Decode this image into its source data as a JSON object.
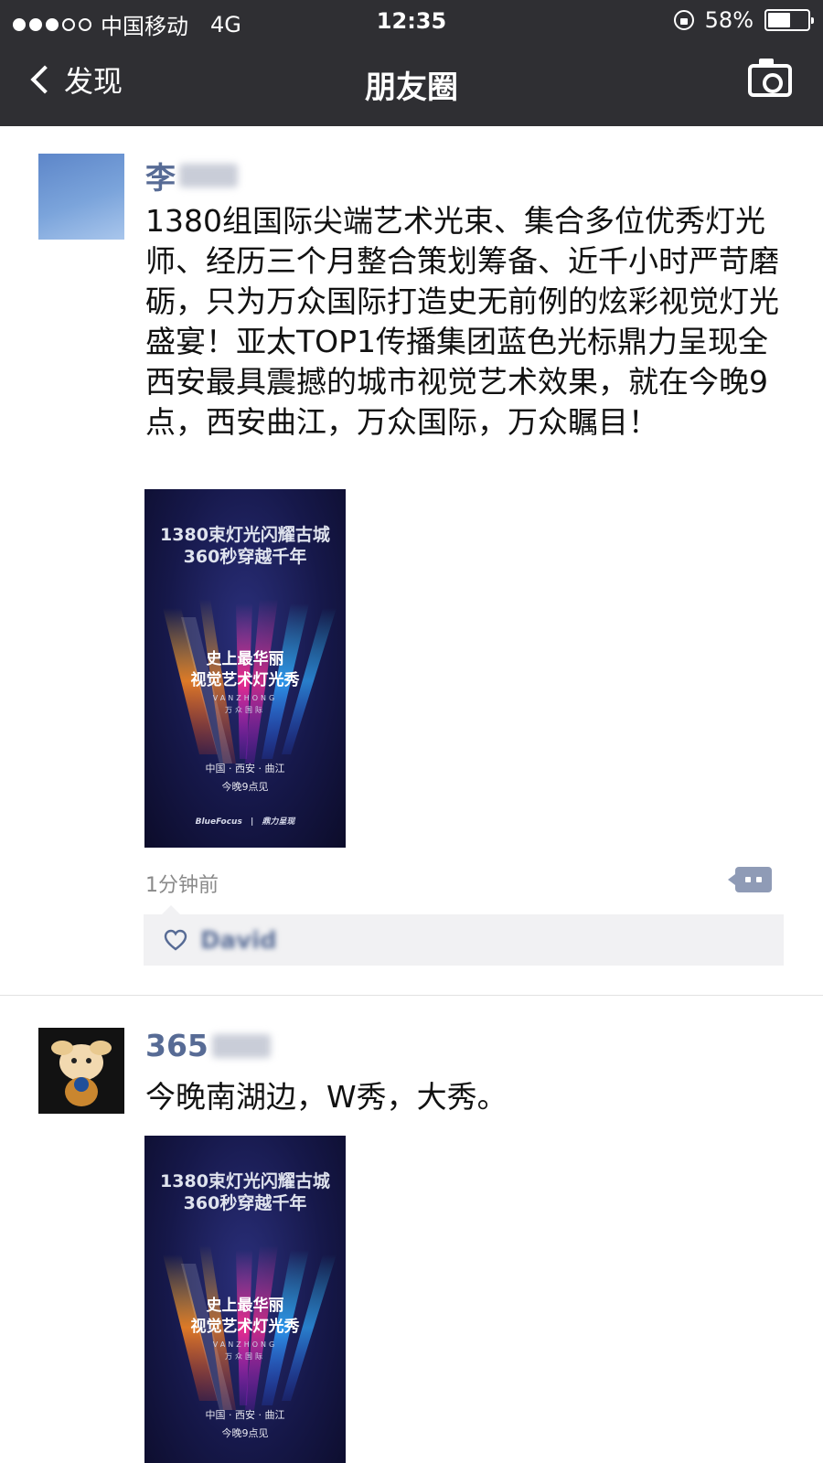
{
  "status_bar": {
    "carrier": "中国移动",
    "network": "4G",
    "time": "12:35",
    "battery": "58%",
    "battery_level": 0.58
  },
  "nav": {
    "back_label": "发现",
    "title": "朋友圈"
  },
  "posts": [
    {
      "author": "李",
      "text": "1380组国际尖端艺术光束、集合多位优秀灯光师、经历三个月整合策划筹备、近千小时严苛磨砺，只为万众国际打造史无前例的炫彩视觉灯光盛宴！亚太TOP1传播集团蓝色光标鼎力呈现全西安最具震撼的城市视觉艺术效果，就在今晚9点，西安曲江，万众国际，万众瞩目！",
      "time": "1分钟前",
      "likes": [
        "David"
      ]
    },
    {
      "author": "365",
      "text": "今晚南湖边，W秀，大秀。"
    }
  ],
  "poster": {
    "title_line1": "1380束灯光闪耀古城",
    "title_line2": "360秒穿越千年",
    "mid_line1": "史上最华丽",
    "mid_line2": "视觉艺术灯光秀",
    "brand_en": "VANZHONG",
    "brand_cn": "万众国际",
    "location": "中国 · 西安 · 曲江",
    "showtime": "今晚9点见",
    "logo1": "BlueFocus",
    "logo2": "鼎力呈现"
  },
  "colors": {
    "nav_bg": "#2f2f33",
    "name_link": "#576b95",
    "likes_bg": "#f1f1f3"
  }
}
